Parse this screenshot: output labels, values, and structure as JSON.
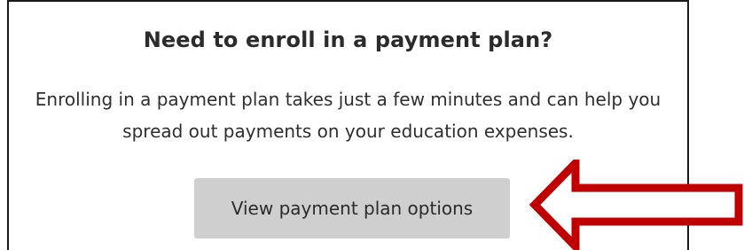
{
  "card": {
    "title": "Need to enroll in a payment plan?",
    "description_line1": "Enrolling in a payment plan takes just a few minutes and can help you",
    "description_line2": "spread out payments on your education expenses.",
    "button_label": "View payment plan options"
  },
  "annotation": {
    "arrow_icon": "left-arrow-icon",
    "arrow_color": "#c00000"
  },
  "colors": {
    "button_bg": "#cfcfcf",
    "text": "#2b2b2b",
    "border": "#1a1a1a"
  }
}
